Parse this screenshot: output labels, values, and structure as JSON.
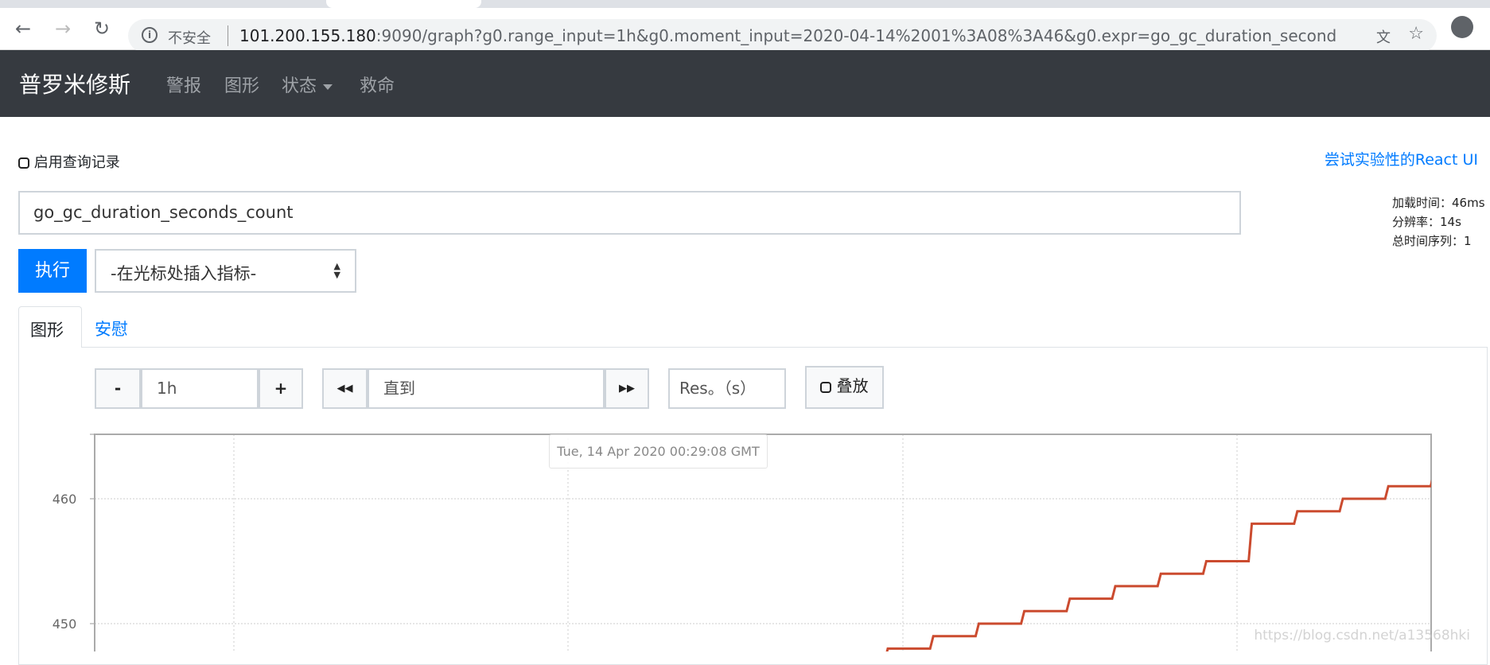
{
  "browser": {
    "insecure_label": "不安全",
    "url_host": "101.200.155.180",
    "url_rest": ":9090/graph?g0.range_input=1h&g0.moment_input=2020-04-14%2001%3A08%3A46&g0.expr=go_gc_duration_second..."
  },
  "navbar": {
    "brand": "普罗米修斯",
    "items": [
      {
        "label": "警报"
      },
      {
        "label": "图形"
      },
      {
        "label": "状态"
      },
      {
        "label": "救命"
      }
    ]
  },
  "query": {
    "history_label": "启用查询记录",
    "react_link": "尝试实验性的React UI",
    "expression": "go_gc_duration_seconds_count",
    "execute_label": "执行",
    "metric_select": "-在光标处插入指标-",
    "stats": {
      "load_time": "加载时间：46ms",
      "resolution": "分辨率：14s",
      "total_series": "总时间序列：1"
    }
  },
  "tabs": [
    {
      "label": "图形",
      "active": true
    },
    {
      "label": "安慰",
      "active": false
    }
  ],
  "graph_controls": {
    "minus": "-",
    "range": "1h",
    "plus": "+",
    "back": "◀◀",
    "until_placeholder": "直到",
    "forward": "▶▶",
    "res_placeholder": "Res。（s）",
    "stacked_label": "叠放"
  },
  "hover_time": "Tue, 14 Apr 2020 00:29:08 GMT",
  "watermark": "https://blog.csdn.net/a13568hki",
  "chart_data": {
    "type": "line",
    "step": true,
    "line_color": "#cb4b2f",
    "y_ticks": [
      450,
      460
    ],
    "ylim": [
      445,
      465.2
    ],
    "grid": true,
    "series": [
      {
        "values": [
          447,
          448,
          449,
          450,
          451,
          452,
          453,
          454,
          455,
          458,
          459,
          460,
          461,
          462
        ]
      }
    ]
  }
}
